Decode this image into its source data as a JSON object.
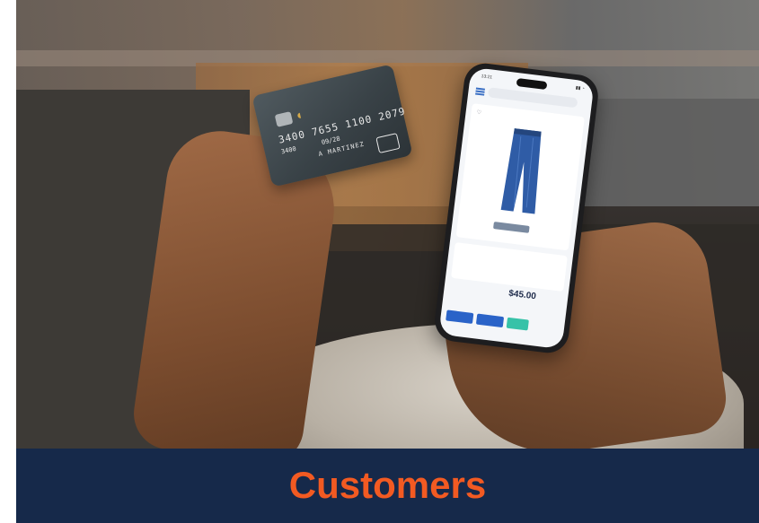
{
  "banner": {
    "title": "Customers"
  },
  "card": {
    "number": "3400 7655 1100 2079",
    "small_code": "3400",
    "expiry_label": "09/28",
    "holder": "A MARTINEZ"
  },
  "phone": {
    "status_time": "13:21",
    "price": "$45.00",
    "icons": {
      "menu": "menu-icon",
      "heart": "heart-icon"
    }
  },
  "colors": {
    "banner_bg": "#16294a",
    "banner_text": "#f25a22",
    "phone_button_blue": "#2a63c8",
    "phone_button_teal": "#36c2a8"
  }
}
